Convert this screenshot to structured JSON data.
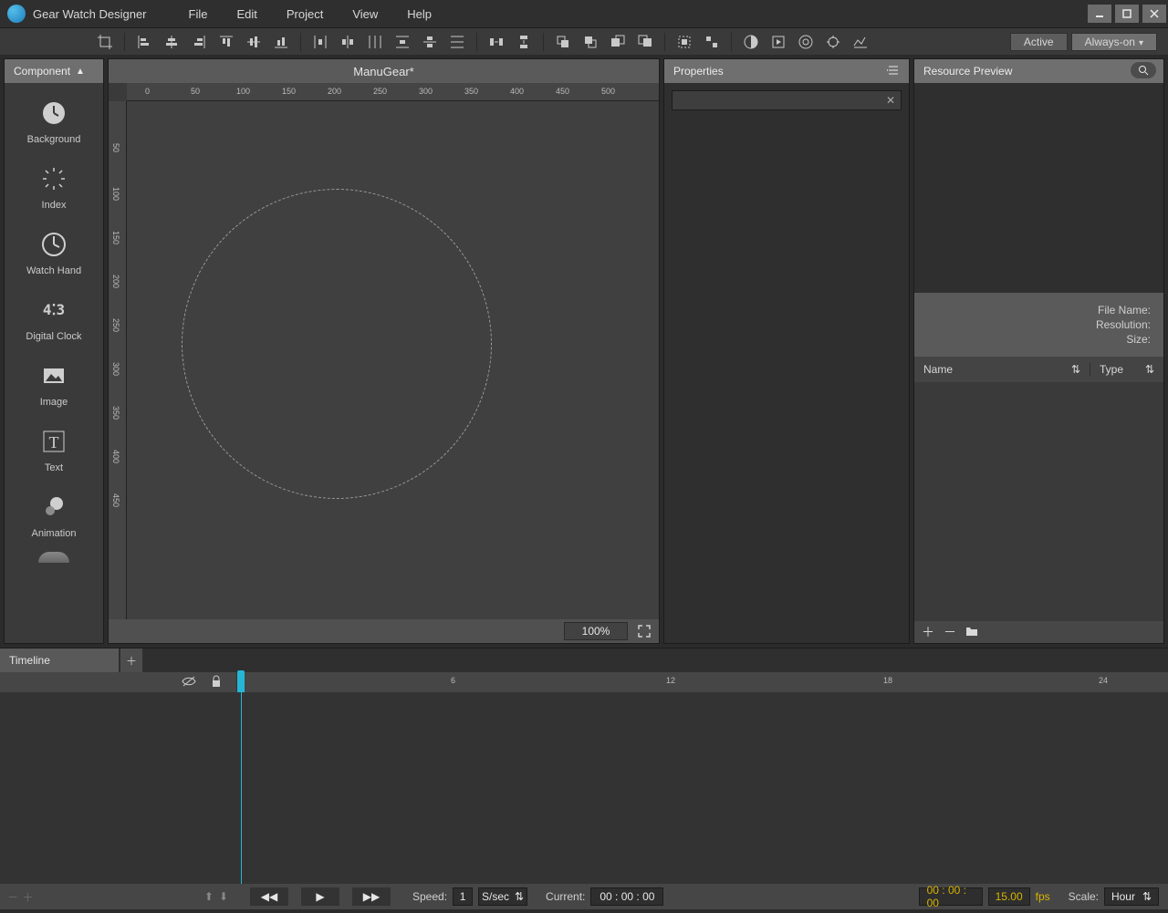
{
  "app": {
    "title": "Gear Watch Designer"
  },
  "menus": {
    "file": "File",
    "edit": "Edit",
    "project": "Project",
    "view": "View",
    "help": "Help"
  },
  "modes": {
    "active": "Active",
    "always_on": "Always-on"
  },
  "panels": {
    "component": "Component",
    "properties": "Properties",
    "resource_preview": "Resource Preview",
    "timeline": "Timeline"
  },
  "document": {
    "tab_title": "ManuGear*"
  },
  "components": [
    {
      "label": "Background"
    },
    {
      "label": "Index"
    },
    {
      "label": "Watch Hand"
    },
    {
      "label": "Digital Clock"
    },
    {
      "label": "Image"
    },
    {
      "label": "Text"
    },
    {
      "label": "Animation"
    }
  ],
  "canvas": {
    "zoom": "100%",
    "ruler_h": [
      "0",
      "50",
      "100",
      "150",
      "200",
      "250",
      "300",
      "350",
      "400",
      "450",
      "500"
    ],
    "ruler_v": [
      "50",
      "100",
      "150",
      "200",
      "250",
      "300",
      "350",
      "400",
      "450"
    ]
  },
  "resource": {
    "file_name_label": "File Name:",
    "resolution_label": "Resolution:",
    "size_label": "Size:",
    "col_name": "Name",
    "col_type": "Type"
  },
  "timeline": {
    "marks": {
      "m6": "6",
      "m12": "12",
      "m18": "18",
      "m24": "24"
    },
    "speed_label": "Speed:",
    "speed_value": "1",
    "speed_unit": "S/sec",
    "current_label": "Current:",
    "current_value": "00 : 00 : 00",
    "pos_value": "00 : 00 : 00",
    "fps_value": "15.00",
    "fps_unit": "fps",
    "scale_label": "Scale:",
    "scale_value": "Hour"
  }
}
